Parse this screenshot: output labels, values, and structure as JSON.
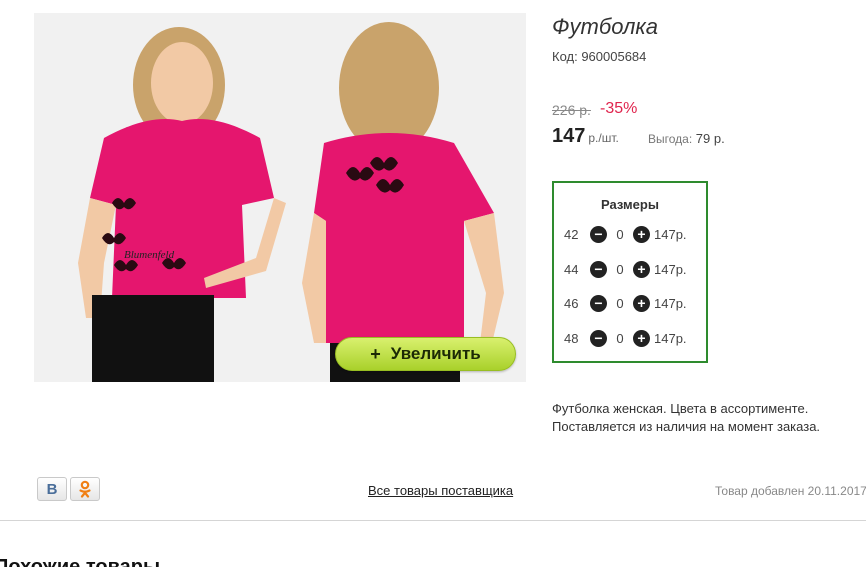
{
  "product": {
    "title": "Футболка",
    "code": "Код: 960005684",
    "old_price": "226 р.",
    "discount": "-35%",
    "price": "147",
    "price_unit": "р./шт.",
    "benefit_label": "Выгода:",
    "benefit_value": "79 р.",
    "description": "Футболка женская. Цвета в ассортименте. Поставляется из наличия на момент заказа.",
    "image": {
      "zoom_label": "Увеличить",
      "zoom_plus": "+",
      "shirt_color": "#e5166e",
      "print_text": "Blumenfeld"
    }
  },
  "sizes": {
    "title": "Размеры",
    "rows": [
      {
        "size": "42",
        "qty": "0",
        "price": "147р."
      },
      {
        "size": "44",
        "qty": "0",
        "price": "147р."
      },
      {
        "size": "46",
        "qty": "0",
        "price": "147р."
      },
      {
        "size": "48",
        "qty": "0",
        "price": "147р."
      }
    ],
    "minus": "−",
    "plus": "+"
  },
  "footer": {
    "supplier_link": "Все товары поставщика",
    "added": "Товар добавлен 20.11.2017",
    "social": [
      {
        "icon": "vk-icon",
        "glyph": "В"
      },
      {
        "icon": "odnoklassniki-icon"
      }
    ]
  },
  "similar": {
    "heading": "Похожие товары"
  },
  "colors": {
    "accent_green": "#2e8b2e",
    "discount_red": "#e0244d",
    "zoom_green": "#a9d12b"
  }
}
